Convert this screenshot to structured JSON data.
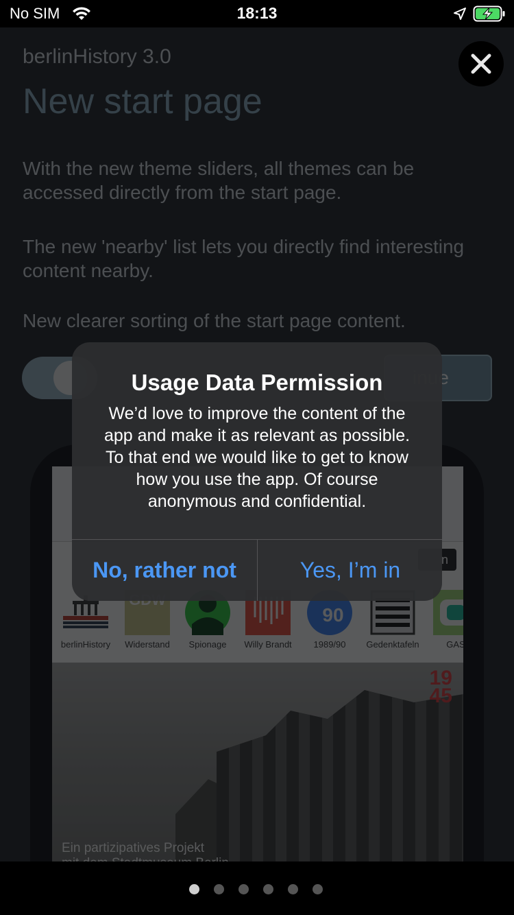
{
  "status_bar": {
    "carrier": "No SIM",
    "time": "18:13",
    "icons": [
      "wifi-icon",
      "location-arrow-icon",
      "battery-charging-icon"
    ]
  },
  "page": {
    "app_version": "berlinHistory 3.0",
    "title": "New start page",
    "paragraphs": [
      "With the new theme sliders, all themes can be accessed directly from the start page.",
      "The new 'nearby' list lets you directly find interesting content nearby.",
      "New clearer sorting of the start page content."
    ],
    "continue_label": "inue"
  },
  "mockup": {
    "search_label": "n",
    "themes": [
      {
        "label": "berlinHistory",
        "icon": "brandenburg-gate-icon"
      },
      {
        "label": "Widerstand",
        "icon": "gdw-logo",
        "logo_text": "GDW"
      },
      {
        "label": "Spionage",
        "icon": "spy-icon"
      },
      {
        "label": "Willy Brandt",
        "icon": "willy-brandt-icon"
      },
      {
        "label": "1989/90",
        "icon": "1989-90-icon",
        "logo_text": "90"
      },
      {
        "label": "Gedenktafeln",
        "icon": "memorial-plaque-icon"
      },
      {
        "label": "GAS",
        "icon": "gas-icon"
      }
    ],
    "hero_badge_top": "19",
    "hero_badge_bottom": "45",
    "hero_caption_line1": "Ein partizipatives Projekt",
    "hero_caption_line2": "mit dem Stadtmuseum Berlin"
  },
  "alert": {
    "title": "Usage Data Permission",
    "message": "We’d love to improve the content of the app and make it as relevant as possible. To that end we would like to get to know how you use the app. Of course anonymous and confidential.",
    "decline_label": "No, rather not",
    "accept_label": "Yes, I’m in"
  },
  "pagination": {
    "total": 6,
    "active_index": 0
  },
  "colors": {
    "page_bg": "#1f2329",
    "title_accent": "#8fb2c4",
    "alert_bg": "#2c2d2f",
    "alert_button": "#4b97f4"
  }
}
